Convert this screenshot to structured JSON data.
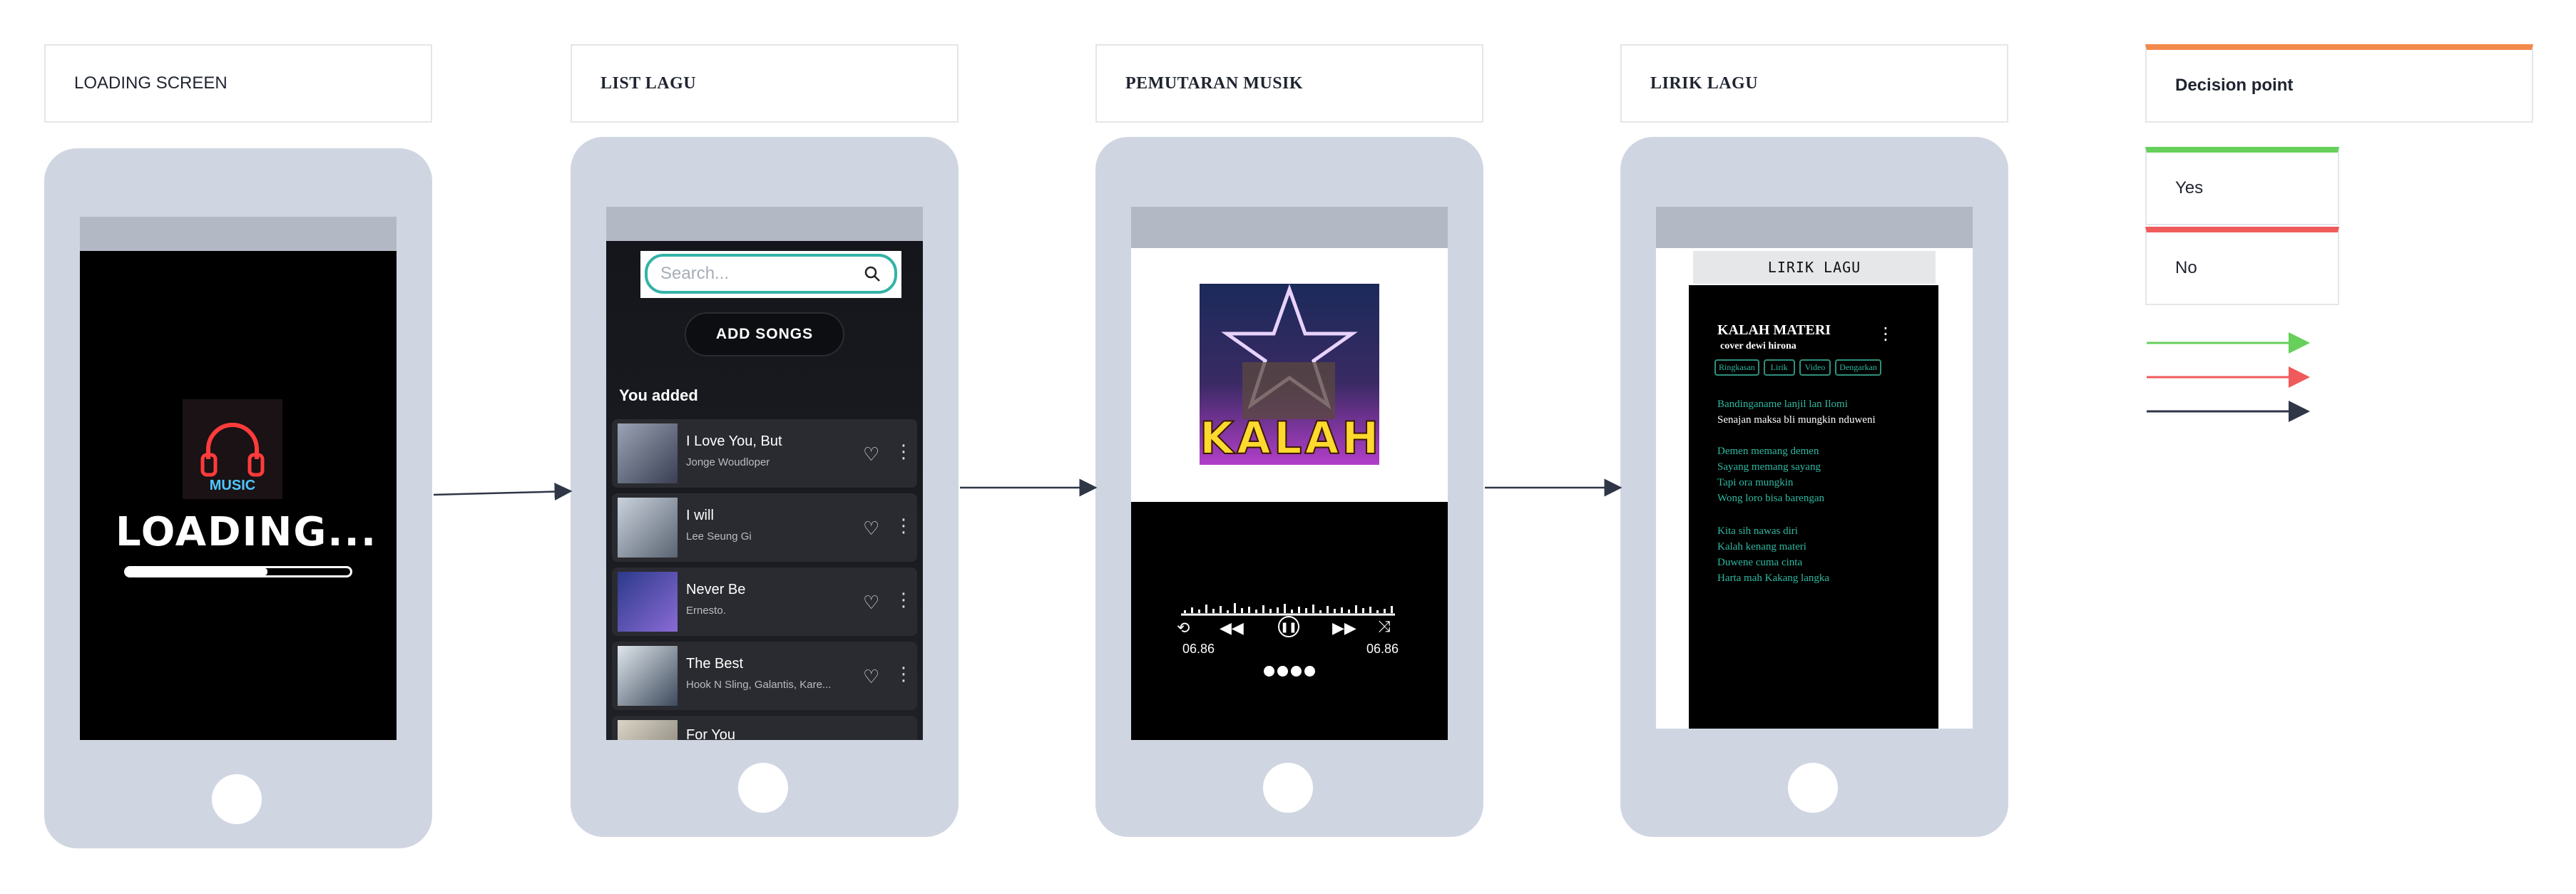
{
  "screens": {
    "loading": {
      "title": "LOADING SCREEN",
      "logo_text": "MUSIC",
      "loading_text": "LOADING...",
      "progress": 0.63
    },
    "list": {
      "title": "LIST LAGU",
      "search_placeholder": "Search...",
      "add_button": "ADD SONGS",
      "section_title": "You added",
      "songs": [
        {
          "title": "I Love You, But",
          "artist": "Jonge Woudloper"
        },
        {
          "title": "I will",
          "artist": "Lee Seung Gi"
        },
        {
          "title": "Never Be",
          "artist": "Ernesto."
        },
        {
          "title": "The Best",
          "artist": "Hook N Sling, Galantis, Kare..."
        },
        {
          "title": "For You",
          "artist": ""
        }
      ]
    },
    "player": {
      "title": "PEMUTARAN MUSIK",
      "cover_text": "KALAH",
      "time_elapsed": "06.86",
      "time_total": "06.86"
    },
    "lyrics": {
      "title": "LIRIK LAGU",
      "banner": "LIRIK LAGU",
      "song_title": "KALAH MATERI",
      "song_subtitle": "cover dewi hirona",
      "tabs": [
        "Ringkasan",
        "Lirik",
        "Video",
        "Dengarkan"
      ],
      "stanza1": [
        "Bandinganame lanjil lan Ilomi",
        "Senajan maksa bli mungkin nduweni"
      ],
      "stanza2": [
        "Demen memang demen",
        "Sayang memang sayang",
        "Tapi ora mungkin",
        "Wong loro bisa barengаn"
      ],
      "stanza3": [
        "Kita sih nawas diri",
        "Kalah kenang materi",
        "Duwene cuma cinta",
        "Harta mah Kakang langka"
      ]
    }
  },
  "legend": {
    "title": "Decision point",
    "yes": "Yes",
    "no": "No",
    "colors": {
      "orange": "#f2894a",
      "green": "#66d05b",
      "red": "#ef5a5a",
      "dark": "#2f3646"
    }
  }
}
